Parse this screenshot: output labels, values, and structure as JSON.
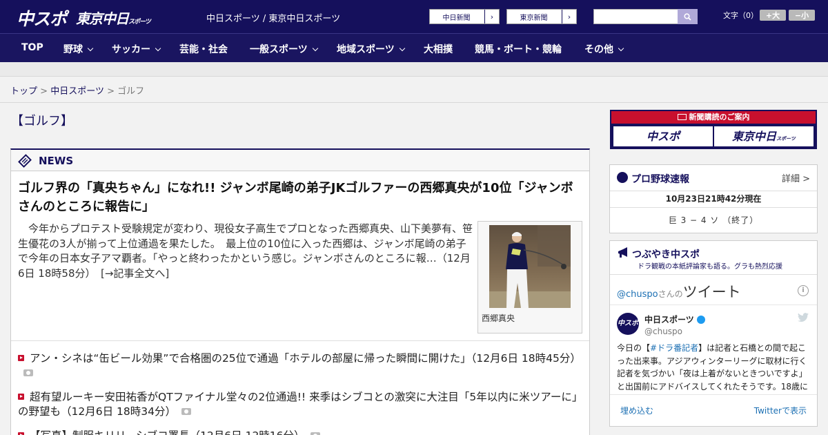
{
  "header": {
    "logo_chuspo": "中スポ",
    "logo_tokyo": "東京中日",
    "logo_tokyo_small": "スポーツ",
    "sites_text": "中日スポーツ / 東京中日スポーツ",
    "newspaper_buttons": [
      "中日新聞",
      "東京新聞"
    ],
    "font_size_label": "文字（0）",
    "font_up": "+大",
    "font_down": "−小"
  },
  "nav": {
    "items": [
      {
        "label": "TOP",
        "has_dropdown": false
      },
      {
        "label": "野球",
        "has_dropdown": true
      },
      {
        "label": "サッカー",
        "has_dropdown": true
      },
      {
        "label": "芸能・社会",
        "has_dropdown": false
      },
      {
        "label": "一般スポーツ",
        "has_dropdown": true
      },
      {
        "label": "地域スポーツ",
        "has_dropdown": true
      },
      {
        "label": "大相撲",
        "has_dropdown": false
      },
      {
        "label": "競馬・ボート・競輪",
        "has_dropdown": false
      },
      {
        "label": "その他",
        "has_dropdown": true
      }
    ]
  },
  "breadcrumb": {
    "items": [
      "トップ",
      "中日スポーツ",
      "ゴルフ"
    ],
    "separator": ">"
  },
  "page_title": "【ゴルフ】",
  "news": {
    "section_title": "NEWS",
    "lead": {
      "headline": "ゴルフ界の「真央ちゃん」になれ!! ジャンボ尾崎の弟子JKゴルファーの西郷真央が10位「ジャンボさんのところに報告に」",
      "body": "今年からプロテスト受験規定が変わり、現役女子高生でプロとなった西郷真央、山下美夢有、笹生優花の3人が揃って上位通過を果たした。　最上位の10位に入った西郷は、ジャンボ尾崎の弟子で今年の日本女子アマ覇者。「やっと終わったかという感じ。ジャンボさんのところに報…（12月6日 18時58分）",
      "more_link": "[→記事全文へ]",
      "photo_caption": "西郷真央"
    },
    "items": [
      {
        "text": "アン・シネは“缶ビール効果”で合格圏の25位で通過「ホテルの部屋に帰った瞬間に開けた」（12月6日 18時45分）",
        "has_photo": true
      },
      {
        "text": "超有望ルーキー安田祐香がQTファイナル堂々の2位通過!! 来季はシブコとの激突に大注目「5年以内に米ツアーに」の野望も（12月6日 18時34分）",
        "has_photo": true
      },
      {
        "text": "【写真】制服キリリ、シブコ署長（12月6日 12時16分）",
        "has_photo": true
      }
    ]
  },
  "subscribe": {
    "heading": "新聞購読のご案内",
    "logo_chuspo": "中スポ",
    "logo_tokyo": "東京中日",
    "logo_tokyo_small": "スポーツ"
  },
  "baseball": {
    "title": "プロ野球速報",
    "detail_link": "詳細 >",
    "timestamp": "10月23日21時42分現在",
    "score_line": "巨 3 − 4 ソ （終了）"
  },
  "twitter": {
    "title": "つぶやき中スポ",
    "subtitle": "ドラ観戦の本紙評論家も語る。グラも熱烈応援",
    "handle_link": "@chuspo",
    "handle_suffix": "さんの",
    "tweets_label": "ツイート",
    "account_name": "中日スポーツ",
    "account_handle": "@chuspo",
    "avatar_text": "中スポ",
    "tweet_before": "今日の【",
    "tweet_hashtag": "#ドラ番記者",
    "tweet_after": "】は記者と石橋との間で起こった出来事。アジアウィンターリーグに取材に行く記者を気づかい「夜は上着がないときついですよ」と出国前にアドバイスしてくれたそうです。18歳に",
    "embed_link": "埋め込む",
    "view_link": "Twitterで表示"
  },
  "colors": {
    "brand_navy": "#15105c",
    "accent_red": "#c8102e",
    "link_blue": "#1b6fb3"
  },
  "icons": [
    "search-icon",
    "chevron-right-icon",
    "chevron-down-icon",
    "news-icon",
    "play-bullet-icon",
    "camera-icon",
    "baseball-icon",
    "megaphone-icon",
    "info-icon",
    "verified-icon",
    "twitter-bird-icon"
  ]
}
